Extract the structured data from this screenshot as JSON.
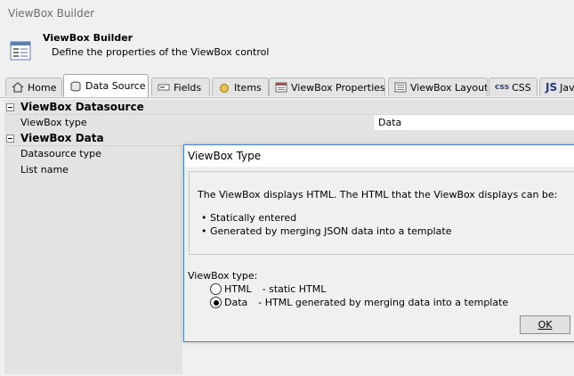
{
  "window": {
    "title": "ViewBox Builder"
  },
  "header": {
    "title": "ViewBox Builder",
    "subtitle": "Define the properties of the ViewBox control",
    "icon": "form-builder-icon"
  },
  "tabs": [
    {
      "label": "Home",
      "icon": "home-icon"
    },
    {
      "label": "Data Source",
      "icon": "database-icon",
      "active": true
    },
    {
      "label": "Fields",
      "icon": "fields-icon"
    },
    {
      "label": "Items",
      "icon": "items-icon"
    },
    {
      "label": "ViewBox Properties",
      "icon": "properties-icon"
    },
    {
      "label": "ViewBox Layout",
      "icon": "layout-icon"
    },
    {
      "label": "CSS",
      "icon": "css-icon"
    },
    {
      "label": "Jav",
      "icon": "js-icon"
    }
  ],
  "grid": {
    "category1": {
      "label": "ViewBox Datasource"
    },
    "row_type": {
      "name": "ViewBox type",
      "value": "Data"
    },
    "category2": {
      "label": "ViewBox Data"
    },
    "row_ds_type": {
      "name": "Datasource type",
      "value": ""
    },
    "row_list": {
      "name": "List name",
      "value": ""
    }
  },
  "dialog": {
    "title": "ViewBox Type",
    "intro": "The ViewBox displays HTML. The HTML that the ViewBox displays can be:",
    "bullets": [
      "Statically entered",
      "Generated by merging JSON data into a template"
    ],
    "type_label": "ViewBox type:",
    "options": [
      {
        "label": "HTML",
        "desc": "- static HTML",
        "selected": false
      },
      {
        "label": "Data",
        "desc": "- HTML generated by merging data into a template",
        "selected": true
      }
    ],
    "ok_label": "OK"
  }
}
